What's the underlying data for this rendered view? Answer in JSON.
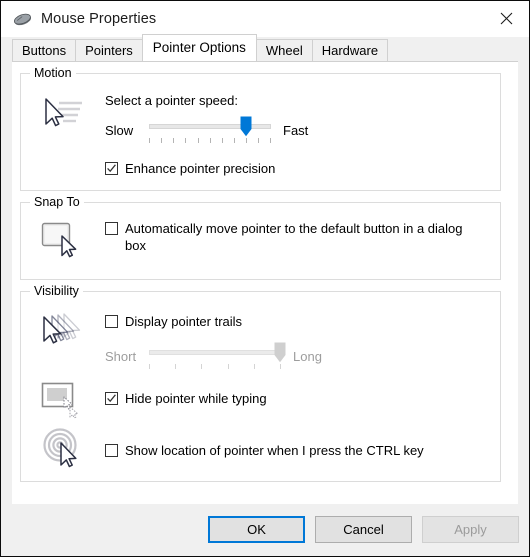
{
  "window": {
    "title": "Mouse Properties",
    "icon": "mouse-icon",
    "close_label": "✕"
  },
  "tabs": [
    {
      "label": "Buttons",
      "active": false
    },
    {
      "label": "Pointers",
      "active": false
    },
    {
      "label": "Pointer Options",
      "active": true
    },
    {
      "label": "Wheel",
      "active": false
    },
    {
      "label": "Hardware",
      "active": false
    }
  ],
  "motion": {
    "group_title": "Motion",
    "speed_label": "Select a pointer speed:",
    "slow_label": "Slow",
    "fast_label": "Fast",
    "slider": {
      "value": 9,
      "min": 1,
      "max": 11,
      "ticks": 11,
      "enabled": true
    },
    "enhance_precision": {
      "label": "Enhance pointer precision",
      "checked": true
    },
    "icon": "pointer-speed-icon"
  },
  "snap_to": {
    "group_title": "Snap To",
    "snap_checkbox": {
      "label": "Automatically move pointer to the default button in a dialog box",
      "checked": false
    },
    "icon": "snap-to-button-icon"
  },
  "visibility": {
    "group_title": "Visibility",
    "trails": {
      "label": "Display pointer trails",
      "checked": false,
      "icon": "pointer-trails-icon",
      "short_label": "Short",
      "long_label": "Long",
      "slider": {
        "value": 6,
        "min": 1,
        "max": 6,
        "ticks": 6,
        "enabled": false
      }
    },
    "hide_while_typing": {
      "label": "Hide pointer while typing",
      "checked": true,
      "icon": "hide-pointer-typing-icon"
    },
    "show_location": {
      "label": "Show location of pointer when I press the CTRL key",
      "checked": false,
      "icon": "ctrl-locate-pointer-icon"
    }
  },
  "buttons": {
    "ok": "OK",
    "cancel": "Cancel",
    "apply": "Apply"
  },
  "colors": {
    "accent": "#0078d7",
    "window_bg": "#f0f0f0",
    "page_bg": "#ffffff",
    "group_border": "#dcdcdc",
    "disabled_text": "#9d9d9d"
  }
}
